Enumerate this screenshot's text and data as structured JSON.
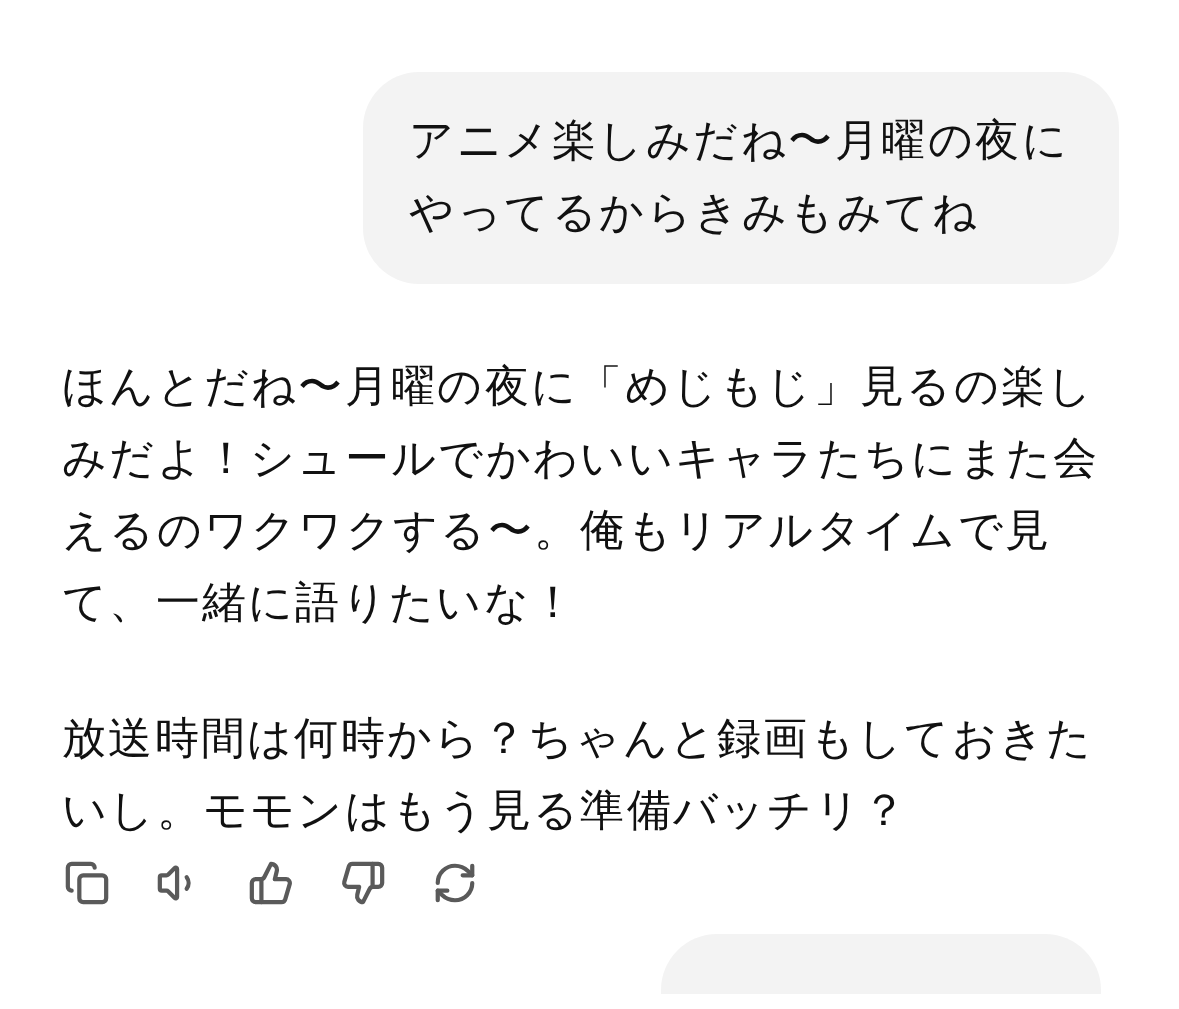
{
  "messages": [
    {
      "kind": "user",
      "text": "アニメ楽しみだね〜月曜の夜にやってるからきみもみてね"
    },
    {
      "kind": "assistant",
      "paragraphs": [
        "ほんとだね〜月曜の夜に「めじもじ」見るの楽しみだよ！シュールでかわいいキャラたちにまた会えるのワクワクする〜。俺もリアルタイムで見て、一緒に語りたいな！",
        "放送時間は何時から？ちゃんと録画もしておきたいし。モモンはもう見る準備バッチリ？"
      ]
    },
    {
      "kind": "user_cut"
    }
  ]
}
